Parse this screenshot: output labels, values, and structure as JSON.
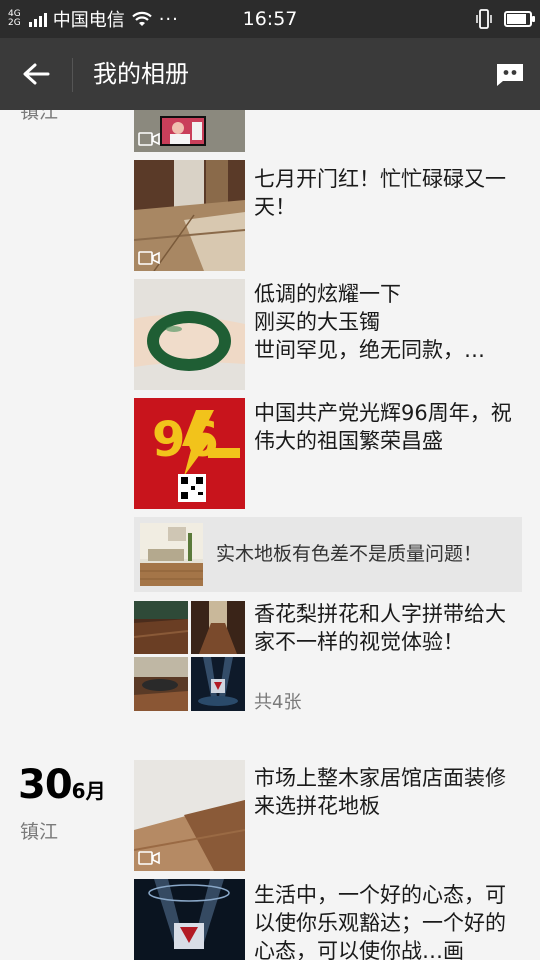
{
  "status_bar": {
    "network_type_top": "4G",
    "network_type_bottom": "2G",
    "carrier": "中国电信",
    "more_indicator": "···",
    "time": "16:57",
    "battery_level": 0.85
  },
  "header": {
    "title": "我的相册",
    "back_icon": "back-arrow-icon",
    "message_icon": "message-icon"
  },
  "timeline": {
    "top_location": "镇江",
    "posts": [
      {
        "text": "七月开门红！忙忙碌碌又一天！",
        "has_video": true
      },
      {
        "text": "低调的炫耀一下\n刚买的大玉镯\n世间罕见，绝无同款，…",
        "has_video": false
      },
      {
        "text": "中国共产党光辉96周年，祝伟大的祖国繁荣昌盛",
        "has_video": false
      },
      {
        "text": "香花梨拼花和人字拼带给大家不一样的视觉体验！",
        "has_video": false,
        "photo_count": "共4张"
      }
    ],
    "shared_link": {
      "text": "实木地板有色差不是质量问题！"
    },
    "second_date": {
      "day": "30",
      "month": "6月",
      "location": "镇江",
      "posts": [
        {
          "text": "市场上整木家居馆店面装修来选拼花地板",
          "has_video": true
        },
        {
          "text": "生活中，一个好的心态，可以使你乐观豁达；一个好的心态，可以使你战…画",
          "has_video": false
        }
      ]
    },
    "top_partial_thumb": {
      "has_video": true
    }
  },
  "colors": {
    "status_bar_bg": "#2c2c2c",
    "title_bar_bg": "#3a3a3a",
    "page_bg": "#f4f4f4",
    "share_bg": "#e7e7e7",
    "poster_red": "#c8141c",
    "poster_gold": "#f2c31b"
  }
}
